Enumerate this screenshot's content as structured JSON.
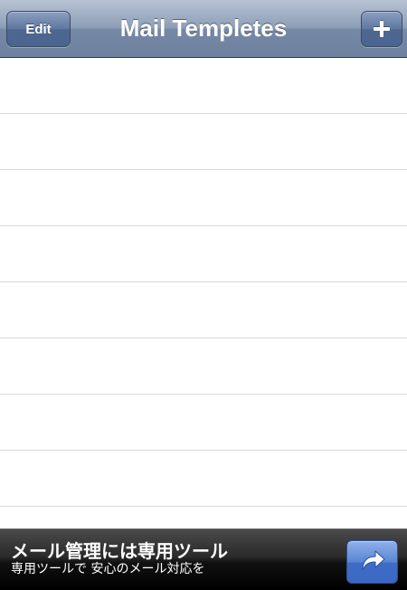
{
  "navbar": {
    "title": "Mail Templetes",
    "edit_label": "Edit",
    "add_icon": "plus-icon"
  },
  "table": {
    "rows": [
      "",
      "",
      "",
      "",
      "",
      "",
      "",
      ""
    ]
  },
  "ad_banner": {
    "title": "メール管理には専用ツール",
    "subtitle": "専用ツールで 安心のメール対応を",
    "action_icon": "share-arrow-icon"
  },
  "colors": {
    "navbar": "#8e9fb7",
    "nav_button": "#5f789f",
    "ad_background": "#1a1a1a",
    "ad_button": "#4a78cc",
    "row_separator": "#d9d9d9"
  }
}
